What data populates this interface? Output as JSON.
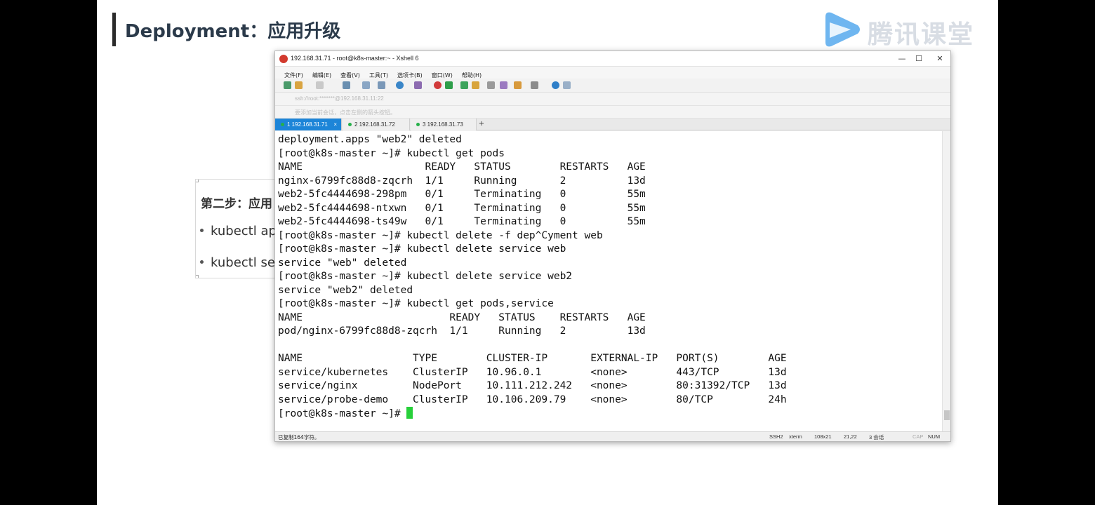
{
  "slide": {
    "title": "Deployment：应用升级",
    "logo_text": "腾讯课堂",
    "card": {
      "title": "第二步：应用",
      "bullets": [
        "kubectl ap",
        "kubectl se"
      ]
    }
  },
  "window": {
    "title": "192.168.31.71 - root@k8s-master:~ - Xshell 6",
    "controls": {
      "minimize": "—",
      "maximize": "☐",
      "close": "✕"
    },
    "menu": [
      "文件(F)",
      "编辑(E)",
      "查看(V)",
      "工具(T)",
      "选项卡(B)",
      "窗口(W)",
      "帮助(H)"
    ],
    "address": "ssh://root:*******@192.168.31.11:22",
    "hint": "要添加当前会话，点击左侧的箭头按钮。",
    "tabs": [
      {
        "label": "1 192.168.31.71",
        "active": true
      },
      {
        "label": "2 192.168.31.72",
        "active": false
      },
      {
        "label": "3 192.168.31.73",
        "active": false
      }
    ],
    "tab_add": "+",
    "tab_close": "×"
  },
  "terminal": {
    "lines": [
      "deployment.apps \"web2\" deleted",
      "[root@k8s-master ~]# kubectl get pods",
      "NAME                    READY   STATUS        RESTARTS   AGE",
      "nginx-6799fc88d8-zqcrh  1/1     Running       2          13d",
      "web2-5fc4444698-298pm   0/1     Terminating   0          55m",
      "web2-5fc4444698-ntxwn   0/1     Terminating   0          55m",
      "web2-5fc4444698-ts49w   0/1     Terminating   0          55m",
      "[root@k8s-master ~]# kubectl delete -f dep^Cyment web",
      "[root@k8s-master ~]# kubectl delete service web",
      "service \"web\" deleted",
      "[root@k8s-master ~]# kubectl delete service web2",
      "service \"web2\" deleted",
      "[root@k8s-master ~]# kubectl get pods,service",
      "NAME                        READY   STATUS    RESTARTS   AGE",
      "pod/nginx-6799fc88d8-zqcrh  1/1     Running   2          13d",
      "",
      "NAME                  TYPE        CLUSTER-IP       EXTERNAL-IP   PORT(S)        AGE",
      "service/kubernetes    ClusterIP   10.96.0.1        <none>        443/TCP        13d",
      "service/nginx         NodePort    10.111.212.242   <none>        80:31392/TCP   13d",
      "service/probe-demo    ClusterIP   10.106.209.79    <none>        80/TCP         24h"
    ],
    "prompt": "[root@k8s-master ~]# "
  },
  "status": {
    "left": "已复制164字符。",
    "protocol": "SSH2",
    "term": "xterm",
    "size": "108x21",
    "pos": "21,22",
    "sessions": "3 会话",
    "cap": "CAP",
    "num": "NUM"
  },
  "colors": {
    "active_tab": "#1d85d8",
    "cursor": "#27d03a",
    "slide_title": "#2b3a4a"
  }
}
